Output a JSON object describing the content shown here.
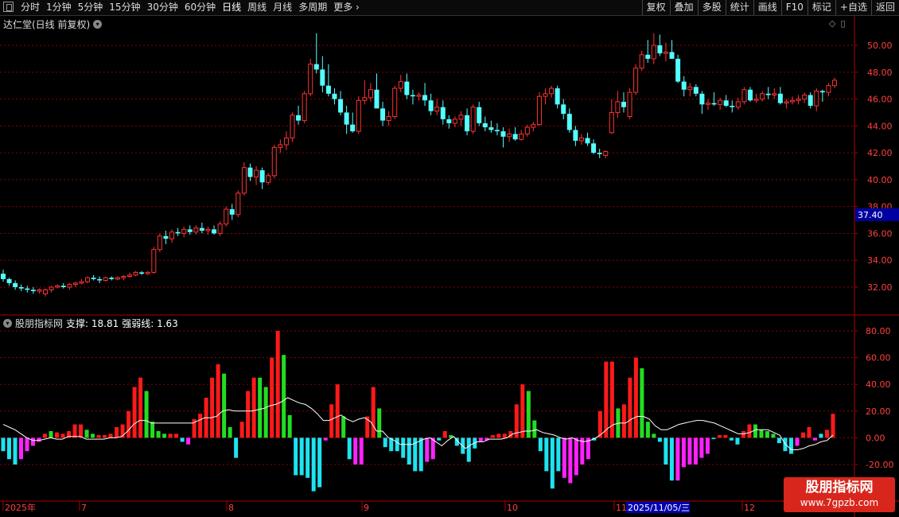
{
  "toolbar": {
    "periods": [
      "分时",
      "1分钟",
      "5分钟",
      "15分钟",
      "30分钟",
      "60分钟",
      "日线",
      "周线",
      "月线",
      "多周期",
      "更多 ›"
    ],
    "active_period": "日线",
    "right_buttons": [
      "复权",
      "叠加",
      "多股",
      "统计",
      "画线",
      "F10",
      "标记",
      "+自选",
      "返回"
    ]
  },
  "main_chart": {
    "title": "达仁堂(日线 前复权)",
    "current_price_label": "37.40",
    "y_ticks": [
      "50.00",
      "48.00",
      "46.00",
      "44.00",
      "42.00",
      "40.00",
      "38.00",
      "36.00",
      "34.00",
      "32.00"
    ]
  },
  "indicator": {
    "name": "股朋指标网",
    "support_label": "支撑: 18.81",
    "strength_label": "强弱线: 1.63",
    "y_ticks": [
      "80.00",
      "60.00",
      "40.00",
      "20.00",
      "0.00",
      "-20.00"
    ]
  },
  "x_axis": {
    "labels": [
      "2025年",
      "7",
      "8",
      "9",
      "10",
      "11",
      "12"
    ],
    "cursor_date": "2025/11/05/三"
  },
  "watermark": {
    "line1": "股朋指标网",
    "line2": "www.7gpzb.com"
  },
  "colors": {
    "up": "#ff3232",
    "down": "#54ffff",
    "grid": "#8b0000",
    "bar_red": "#ff1a1a",
    "bar_green": "#22dd22",
    "bar_cyan": "#1ee3f0",
    "bar_magenta": "#ff22ff",
    "line": "#ffffff"
  },
  "chart_data": {
    "type": "candlestick",
    "candles": [
      [
        33.0,
        33.3,
        32.4,
        32.6
      ],
      [
        32.6,
        32.7,
        32.1,
        32.3
      ],
      [
        32.3,
        32.5,
        31.8,
        32.0
      ],
      [
        32.0,
        32.2,
        31.7,
        31.9
      ],
      [
        31.9,
        32.1,
        31.6,
        31.8
      ],
      [
        31.8,
        32.0,
        31.5,
        31.7
      ],
      [
        31.7,
        31.9,
        31.5,
        31.8
      ],
      [
        31.5,
        31.9,
        31.3,
        31.8
      ],
      [
        31.8,
        32.1,
        31.6,
        32.0
      ],
      [
        32.0,
        32.2,
        31.9,
        32.1
      ],
      [
        32.1,
        32.3,
        31.9,
        32.0
      ],
      [
        32.0,
        32.3,
        31.8,
        32.2
      ],
      [
        32.2,
        32.4,
        32.0,
        32.3
      ],
      [
        32.3,
        32.6,
        32.2,
        32.4
      ],
      [
        32.4,
        32.8,
        32.3,
        32.7
      ],
      [
        32.7,
        32.9,
        32.5,
        32.6
      ],
      [
        32.6,
        32.8,
        32.3,
        32.5
      ],
      [
        32.5,
        32.8,
        32.4,
        32.7
      ],
      [
        32.7,
        32.8,
        32.5,
        32.6
      ],
      [
        32.6,
        32.8,
        32.5,
        32.7
      ],
      [
        32.7,
        32.9,
        32.5,
        32.8
      ],
      [
        32.8,
        33.1,
        32.7,
        32.9
      ],
      [
        32.9,
        33.2,
        32.8,
        33.1
      ],
      [
        33.1,
        33.2,
        32.9,
        33.0
      ],
      [
        33.0,
        33.2,
        32.9,
        33.1
      ],
      [
        33.1,
        35.0,
        33.0,
        34.8
      ],
      [
        34.8,
        36.0,
        34.6,
        35.8
      ],
      [
        35.8,
        36.2,
        35.2,
        35.6
      ],
      [
        35.6,
        36.3,
        35.3,
        36.1
      ],
      [
        36.1,
        36.4,
        35.8,
        36.0
      ],
      [
        36.0,
        36.5,
        35.7,
        36.3
      ],
      [
        36.3,
        36.6,
        35.9,
        36.1
      ],
      [
        36.1,
        36.6,
        35.9,
        36.4
      ],
      [
        36.4,
        36.8,
        36.0,
        36.2
      ],
      [
        36.2,
        36.5,
        35.9,
        36.3
      ],
      [
        36.3,
        36.6,
        35.9,
        36.0
      ],
      [
        36.0,
        36.9,
        35.8,
        36.7
      ],
      [
        36.7,
        38.0,
        36.5,
        37.8
      ],
      [
        37.8,
        38.2,
        37.0,
        37.4
      ],
      [
        37.4,
        39.2,
        37.2,
        39.0
      ],
      [
        39.0,
        41.3,
        38.8,
        40.9
      ],
      [
        40.9,
        41.2,
        39.9,
        40.2
      ],
      [
        40.2,
        41.0,
        39.6,
        40.7
      ],
      [
        40.7,
        40.9,
        39.3,
        39.8
      ],
      [
        39.8,
        40.5,
        39.6,
        40.3
      ],
      [
        40.3,
        42.6,
        40.1,
        42.4
      ],
      [
        42.4,
        43.0,
        42.0,
        42.6
      ],
      [
        42.6,
        43.6,
        42.2,
        43.1
      ],
      [
        43.1,
        45.0,
        42.8,
        44.8
      ],
      [
        44.8,
        45.5,
        44.1,
        44.4
      ],
      [
        44.4,
        46.6,
        44.2,
        46.4
      ],
      [
        46.4,
        49.0,
        46.2,
        48.6
      ],
      [
        48.6,
        50.9,
        47.9,
        48.2
      ],
      [
        48.2,
        49.2,
        46.5,
        47.0
      ],
      [
        47.0,
        48.6,
        46.2,
        46.4
      ],
      [
        46.4,
        46.8,
        45.6,
        46.0
      ],
      [
        46.0,
        46.6,
        44.8,
        45.0
      ],
      [
        45.0,
        45.5,
        43.4,
        44.1
      ],
      [
        44.1,
        45.0,
        43.5,
        43.6
      ],
      [
        43.6,
        46.2,
        43.4,
        45.9
      ],
      [
        45.9,
        47.4,
        45.6,
        46.1
      ],
      [
        46.1,
        47.2,
        45.8,
        46.7
      ],
      [
        46.7,
        47.9,
        45.7,
        45.3
      ],
      [
        45.3,
        45.8,
        44.0,
        44.4
      ],
      [
        44.4,
        45.1,
        44.0,
        44.7
      ],
      [
        44.7,
        47.0,
        44.5,
        46.8
      ],
      [
        46.8,
        47.8,
        46.5,
        47.3
      ],
      [
        47.3,
        47.9,
        46.0,
        46.3
      ],
      [
        46.3,
        46.7,
        45.6,
        46.2
      ],
      [
        46.2,
        46.5,
        45.9,
        46.3
      ],
      [
        46.3,
        47.2,
        45.5,
        45.9
      ],
      [
        45.9,
        46.4,
        44.8,
        45.1
      ],
      [
        45.1,
        46.0,
        44.8,
        45.4
      ],
      [
        45.4,
        45.9,
        44.1,
        44.5
      ],
      [
        44.5,
        44.8,
        43.8,
        44.2
      ],
      [
        44.2,
        44.7,
        43.9,
        44.5
      ],
      [
        44.5,
        45.1,
        44.0,
        44.8
      ],
      [
        44.8,
        45.3,
        43.3,
        43.6
      ],
      [
        43.6,
        45.6,
        43.4,
        45.4
      ],
      [
        45.4,
        45.8,
        44.0,
        44.2
      ],
      [
        44.2,
        44.7,
        43.6,
        43.9
      ],
      [
        43.9,
        44.4,
        43.5,
        43.7
      ],
      [
        43.7,
        44.2,
        43.3,
        43.6
      ],
      [
        43.6,
        43.9,
        42.4,
        43.2
      ],
      [
        43.2,
        43.8,
        42.8,
        43.4
      ],
      [
        43.4,
        43.9,
        42.9,
        43.0
      ],
      [
        43.0,
        43.7,
        42.9,
        43.4
      ],
      [
        43.4,
        44.1,
        43.2,
        43.9
      ],
      [
        43.9,
        44.3,
        43.6,
        44.1
      ],
      [
        44.1,
        46.5,
        44.0,
        46.2
      ],
      [
        46.2,
        46.8,
        45.6,
        46.4
      ],
      [
        46.4,
        47.0,
        46.1,
        46.8
      ],
      [
        46.8,
        47.0,
        45.3,
        45.6
      ],
      [
        45.6,
        46.0,
        44.5,
        44.9
      ],
      [
        44.9,
        45.3,
        43.5,
        43.7
      ],
      [
        43.7,
        44.0,
        42.5,
        42.9
      ],
      [
        42.9,
        43.4,
        42.6,
        43.1
      ],
      [
        43.1,
        43.5,
        42.5,
        42.7
      ],
      [
        42.7,
        43.0,
        41.9,
        42.0
      ],
      [
        42.0,
        42.3,
        41.6,
        41.9
      ],
      [
        41.8,
        42.2,
        41.6,
        42.1
      ],
      [
        43.5,
        46.0,
        43.4,
        45.0
      ],
      [
        45.0,
        46.6,
        44.6,
        45.8
      ],
      [
        45.8,
        46.5,
        45.0,
        45.4
      ],
      [
        44.7,
        46.8,
        44.5,
        46.5
      ],
      [
        46.5,
        48.6,
        46.3,
        48.3
      ],
      [
        48.3,
        49.6,
        48.1,
        49.3
      ],
      [
        49.3,
        50.4,
        48.7,
        49.0
      ],
      [
        49.0,
        50.9,
        48.6,
        50.0
      ],
      [
        50.0,
        50.8,
        49.2,
        49.4
      ],
      [
        49.4,
        50.2,
        48.8,
        49.5
      ],
      [
        49.5,
        50.4,
        49.0,
        49.0
      ],
      [
        49.0,
        49.3,
        47.2,
        47.3
      ],
      [
        47.3,
        47.7,
        46.2,
        46.7
      ],
      [
        46.7,
        47.2,
        46.2,
        46.9
      ],
      [
        46.9,
        47.1,
        46.2,
        46.4
      ],
      [
        46.4,
        46.6,
        44.9,
        45.6
      ],
      [
        45.6,
        46.0,
        45.2,
        45.7
      ],
      [
        45.7,
        46.5,
        45.5,
        45.6
      ],
      [
        45.6,
        46.1,
        45.2,
        45.9
      ],
      [
        45.9,
        46.3,
        45.4,
        45.5
      ],
      [
        45.5,
        45.9,
        45.0,
        45.4
      ],
      [
        45.4,
        46.1,
        45.2,
        45.8
      ],
      [
        45.8,
        46.9,
        45.6,
        46.7
      ],
      [
        46.7,
        46.9,
        45.8,
        45.9
      ],
      [
        45.9,
        46.4,
        45.7,
        46.0
      ],
      [
        46.0,
        46.6,
        45.8,
        46.4
      ],
      [
        46.4,
        46.9,
        46.0,
        46.3
      ],
      [
        46.3,
        46.8,
        46.0,
        46.4
      ],
      [
        46.4,
        46.9,
        45.6,
        45.7
      ],
      [
        45.7,
        46.0,
        45.3,
        45.8
      ],
      [
        45.8,
        46.2,
        45.6,
        45.9
      ],
      [
        45.9,
        46.3,
        45.6,
        46.0
      ],
      [
        46.0,
        46.5,
        45.7,
        46.3
      ],
      [
        46.3,
        46.5,
        45.3,
        45.5
      ],
      [
        45.5,
        46.8,
        45.1,
        46.6
      ],
      [
        46.6,
        46.7,
        45.8,
        46.5
      ],
      [
        46.5,
        47.2,
        46.2,
        47.0
      ],
      [
        47.0,
        47.6,
        46.8,
        47.4
      ]
    ],
    "indicator_bars": [
      [
        -10,
        "c"
      ],
      [
        -16,
        "c"
      ],
      [
        -20,
        "c"
      ],
      [
        -16,
        "m"
      ],
      [
        -10,
        "m"
      ],
      [
        -6,
        "m"
      ],
      [
        -3,
        "m"
      ],
      [
        3,
        "r"
      ],
      [
        5,
        "g"
      ],
      [
        4,
        "r"
      ],
      [
        3,
        "r"
      ],
      [
        5,
        "r"
      ],
      [
        10,
        "r"
      ],
      [
        10,
        "r"
      ],
      [
        6,
        "g"
      ],
      [
        3,
        "g"
      ],
      [
        2,
        "r"
      ],
      [
        2,
        "r"
      ],
      [
        3,
        "r"
      ],
      [
        8,
        "r"
      ],
      [
        10,
        "r"
      ],
      [
        20,
        "r"
      ],
      [
        38,
        "r"
      ],
      [
        45,
        "r"
      ],
      [
        35,
        "g"
      ],
      [
        12,
        "g"
      ],
      [
        5,
        "g"
      ],
      [
        3,
        "g"
      ],
      [
        3,
        "r"
      ],
      [
        3,
        "r"
      ],
      [
        -3,
        "c"
      ],
      [
        -5,
        "m"
      ],
      [
        14,
        "r"
      ],
      [
        18,
        "r"
      ],
      [
        30,
        "r"
      ],
      [
        45,
        "r"
      ],
      [
        55,
        "r"
      ],
      [
        48,
        "g"
      ],
      [
        8,
        "g"
      ],
      [
        -15,
        "c"
      ],
      [
        12,
        "r"
      ],
      [
        35,
        "r"
      ],
      [
        45,
        "r"
      ],
      [
        45,
        "g"
      ],
      [
        38,
        "g"
      ],
      [
        60,
        "r"
      ],
      [
        80,
        "r"
      ],
      [
        62,
        "g"
      ],
      [
        17,
        "g"
      ],
      [
        -28,
        "c"
      ],
      [
        -28,
        "c"
      ],
      [
        -30,
        "c"
      ],
      [
        -40,
        "c"
      ],
      [
        -37,
        "c"
      ],
      [
        -2,
        "m"
      ],
      [
        25,
        "r"
      ],
      [
        40,
        "r"
      ],
      [
        16,
        "g"
      ],
      [
        -16,
        "c"
      ],
      [
        -20,
        "m"
      ],
      [
        -20,
        "m"
      ],
      [
        16,
        "r"
      ],
      [
        38,
        "r"
      ],
      [
        22,
        "g"
      ],
      [
        -7,
        "c"
      ],
      [
        -10,
        "c"
      ],
      [
        -10,
        "c"
      ],
      [
        -15,
        "c"
      ],
      [
        -20,
        "c"
      ],
      [
        -25,
        "c"
      ],
      [
        -25,
        "c"
      ],
      [
        -18,
        "m"
      ],
      [
        -16,
        "m"
      ],
      [
        -2,
        "c"
      ],
      [
        5,
        "r"
      ],
      [
        2,
        "g"
      ],
      [
        -6,
        "c"
      ],
      [
        -12,
        "c"
      ],
      [
        -18,
        "c"
      ],
      [
        -8,
        "c"
      ],
      [
        -3,
        "m"
      ],
      [
        -2,
        "m"
      ],
      [
        2,
        "r"
      ],
      [
        3,
        "r"
      ],
      [
        3,
        "r"
      ],
      [
        5,
        "r"
      ],
      [
        25,
        "r"
      ],
      [
        40,
        "r"
      ],
      [
        35,
        "g"
      ],
      [
        13,
        "g"
      ],
      [
        -10,
        "c"
      ],
      [
        -25,
        "c"
      ],
      [
        -38,
        "c"
      ],
      [
        -25,
        "c"
      ],
      [
        -30,
        "m"
      ],
      [
        -34,
        "m"
      ],
      [
        -28,
        "m"
      ],
      [
        -20,
        "m"
      ],
      [
        -16,
        "m"
      ],
      [
        -2,
        "c"
      ],
      [
        20,
        "r"
      ],
      [
        57,
        "r"
      ],
      [
        57,
        "r"
      ],
      [
        22,
        "g"
      ],
      [
        25,
        "r"
      ],
      [
        45,
        "r"
      ],
      [
        60,
        "r"
      ],
      [
        52,
        "g"
      ],
      [
        12,
        "g"
      ],
      [
        3,
        "g"
      ],
      [
        -3,
        "c"
      ],
      [
        -20,
        "c"
      ],
      [
        -32,
        "c"
      ],
      [
        -32,
        "m"
      ],
      [
        -22,
        "m"
      ],
      [
        -20,
        "m"
      ],
      [
        -20,
        "m"
      ],
      [
        -15,
        "m"
      ],
      [
        -12,
        "m"
      ],
      [
        -1,
        "c"
      ],
      [
        2,
        "r"
      ],
      [
        2,
        "r"
      ],
      [
        -2,
        "c"
      ],
      [
        -5,
        "c"
      ],
      [
        5,
        "r"
      ],
      [
        10,
        "r"
      ],
      [
        10,
        "g"
      ],
      [
        6,
        "g"
      ],
      [
        5,
        "g"
      ],
      [
        3,
        "g"
      ],
      [
        -4,
        "c"
      ],
      [
        -10,
        "c"
      ],
      [
        -12,
        "c"
      ],
      [
        -6,
        "m"
      ],
      [
        4,
        "r"
      ],
      [
        8,
        "r"
      ],
      [
        -2,
        "m"
      ],
      [
        3,
        "c"
      ],
      [
        6,
        "r"
      ],
      [
        18,
        "r"
      ]
    ],
    "strength_line": [
      10,
      8,
      6,
      3,
      0,
      -2,
      -2,
      -1,
      0,
      -1,
      -1,
      1,
      1,
      1,
      -1,
      -1,
      -1,
      -1,
      0,
      0,
      1,
      5,
      10,
      13,
      13,
      11,
      11,
      11,
      11,
      11,
      11,
      11,
      11,
      13,
      15,
      15,
      16,
      20,
      21,
      20,
      20,
      20,
      20,
      21,
      22,
      24,
      25,
      27,
      30,
      28,
      26,
      25,
      22,
      18,
      13,
      13,
      15,
      17,
      14,
      12,
      14,
      15,
      12,
      5,
      5,
      0,
      -2,
      -5,
      -5,
      -5,
      -3,
      -1,
      0,
      -3,
      -6,
      -2,
      1,
      -4,
      -8,
      -5,
      -3,
      -3,
      -1,
      -1,
      -1,
      0,
      3,
      4,
      5,
      5,
      6,
      4,
      3,
      2,
      0,
      -1,
      0,
      -2,
      -3,
      -2,
      0,
      3,
      7,
      10,
      11,
      11,
      14,
      16,
      16,
      14,
      9,
      6,
      6,
      8,
      10,
      11,
      12,
      13,
      13,
      12,
      11,
      9,
      7,
      5,
      3,
      3,
      4,
      6,
      6,
      6,
      4,
      2,
      -5,
      -9,
      -9,
      -8,
      -6,
      -5,
      -3,
      -2,
      2
    ]
  }
}
